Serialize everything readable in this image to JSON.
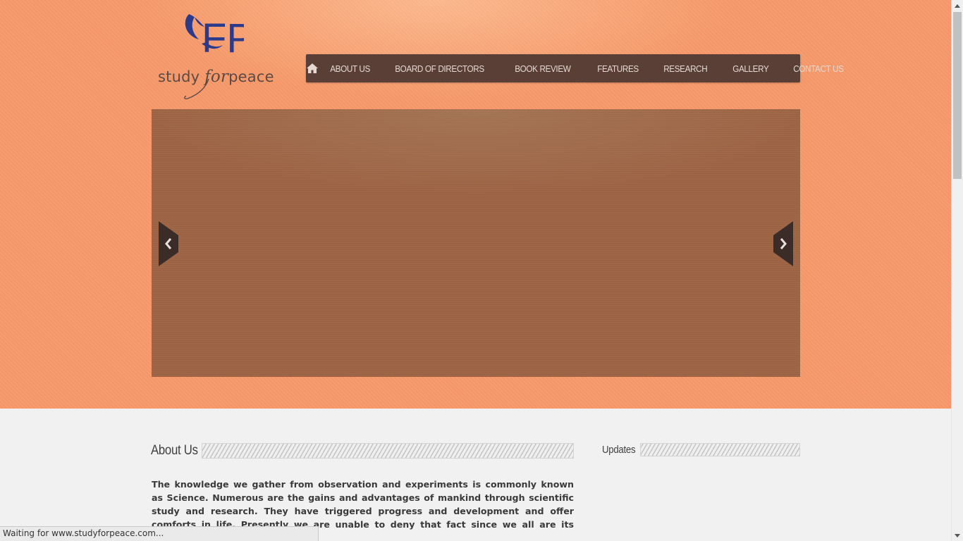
{
  "site": {
    "logo_text_study": "study",
    "logo_text_for": "for",
    "logo_text_peace": "peace",
    "logo_mark_letters": "FP",
    "colors": {
      "header_bg": "#f7996a",
      "nav_bg": "#5a3f36",
      "logo_blue": "#2c3a8c",
      "slider_bg": "#9d6444",
      "content_bg": "#f1f1f1"
    }
  },
  "nav": {
    "home_icon": "home-icon",
    "items": [
      {
        "label": "ABOUT US"
      },
      {
        "label": "BOARD OF DIRECTORS"
      },
      {
        "label": "BOOK REVIEW"
      },
      {
        "label": "FEATURES"
      },
      {
        "label": "RESEARCH"
      },
      {
        "label": "GALLERY"
      },
      {
        "label": "CONTACT US"
      }
    ]
  },
  "slider": {
    "prev_icon": "chevron-left-icon",
    "next_icon": "chevron-right-icon"
  },
  "about": {
    "title": "About Us",
    "text": "The knowledge we gather from observation and experiments is commonly known as Science. Numerous are the gains and advantages of mankind through scientific study and research. They have triggered progress and development and offer comforts in life. Presently we are unable to deny that fact since we all are its beneficiaries."
  },
  "updates": {
    "title": "Updates"
  },
  "status_bar": {
    "text": "Waiting for www.studyforpeace.com..."
  }
}
